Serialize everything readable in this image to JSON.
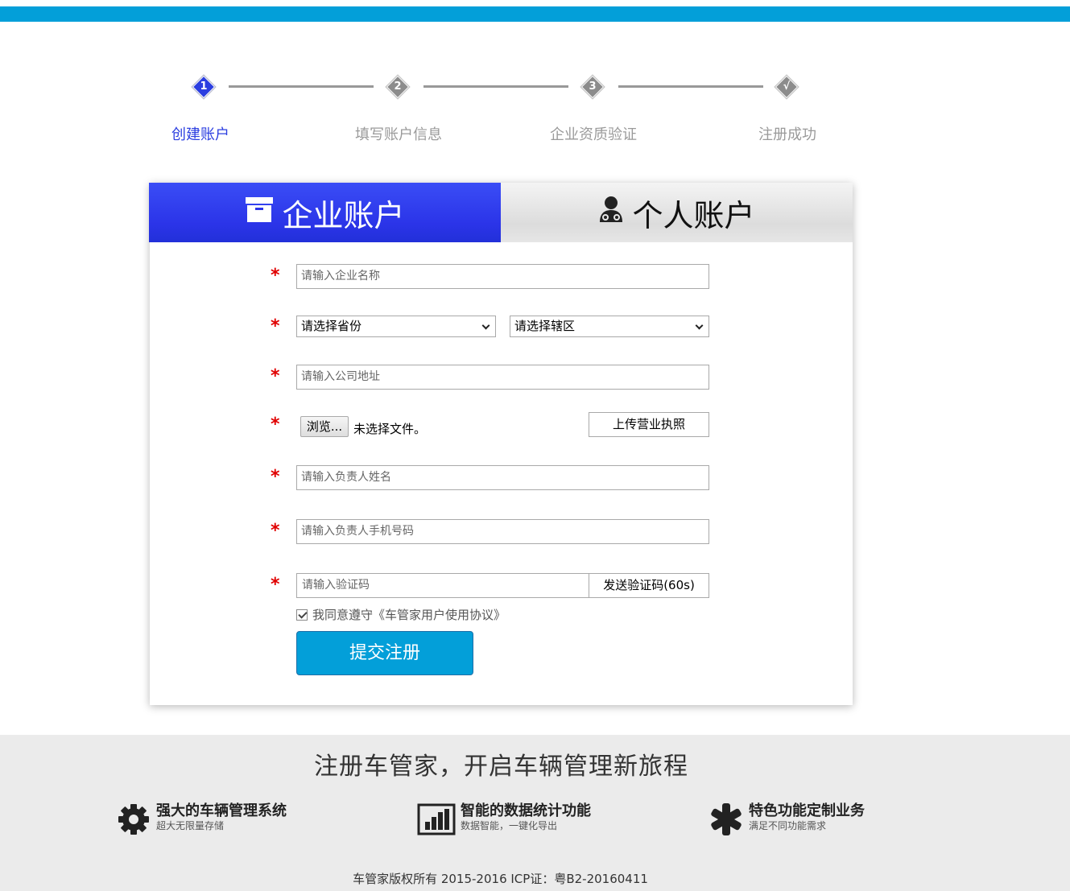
{
  "colors": {
    "accent": "#039fd9",
    "step_active": "#2b3ee0",
    "step_inactive": "#8c8c8c",
    "required": "#e00000",
    "footer_bg": "#ebebeb"
  },
  "steps": [
    {
      "num": "1",
      "label": "创建账户",
      "state": "active"
    },
    {
      "num": "2",
      "label": "填写账户信息",
      "state": "inactive"
    },
    {
      "num": "3",
      "label": "企业资质验证",
      "state": "inactive"
    },
    {
      "num": "√",
      "label": "注册成功",
      "state": "inactive"
    }
  ],
  "tabs": {
    "enterprise": {
      "label": "企业账户",
      "icon": "archive-box-icon",
      "selected": true
    },
    "personal": {
      "label": "个人账户",
      "icon": "user-doctor-icon",
      "selected": false
    }
  },
  "form": {
    "required_mark": "*",
    "company_name": {
      "placeholder": "请输入企业名称",
      "value": ""
    },
    "province": {
      "selected": "请选择省份"
    },
    "district": {
      "selected": "请选择辖区"
    },
    "address": {
      "placeholder": "请输入公司地址",
      "value": ""
    },
    "file": {
      "browse_label": "浏览...",
      "status": "未选择文件。",
      "upload_label": "上传营业执照"
    },
    "manager_name": {
      "placeholder": "请输入负责人姓名",
      "value": ""
    },
    "manager_phone": {
      "placeholder": "请输入负责人手机号码",
      "value": ""
    },
    "code": {
      "placeholder": "请输入验证码",
      "value": "",
      "send_label": "发送验证码(60s)"
    },
    "agreement": {
      "text": "我同意遵守《车管家用户使用协议》",
      "checked": true
    },
    "submit_label": "提交注册"
  },
  "footer": {
    "slogan": "注册车管家，开启车辆管理新旅程",
    "features": [
      {
        "icon": "gear-icon",
        "title": "强大的车辆管理系统",
        "subtitle": "超大无限量存储"
      },
      {
        "icon": "bar-chart-icon",
        "title": "智能的数据统计功能",
        "subtitle": "数据智能，一键化导出"
      },
      {
        "icon": "asterisk-icon",
        "title": "特色功能定制业务",
        "subtitle": "满足不同功能需求"
      }
    ],
    "copyright": "车管家版权所有 2015-2016 ICP证：粤B2-20160411"
  }
}
